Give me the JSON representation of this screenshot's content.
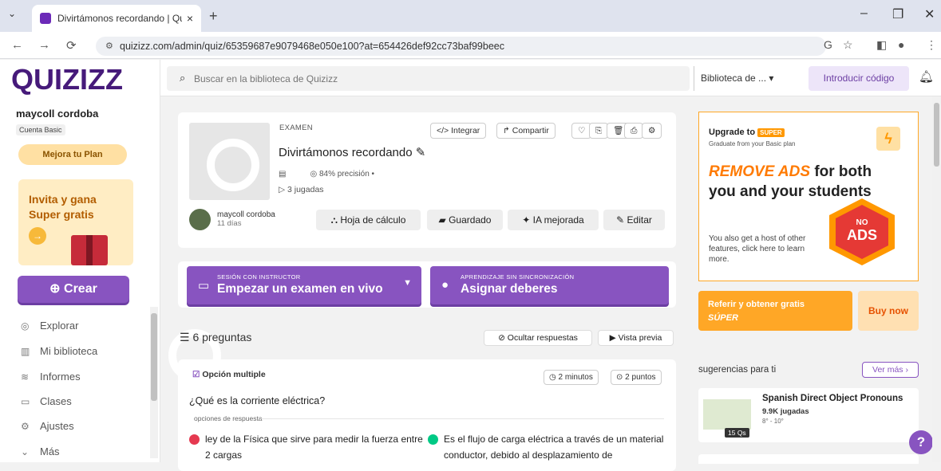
{
  "browser": {
    "tab_title": "Divirtámonos recordando | Qu",
    "url": "quizizz.com/admin/quiz/65359687e9079468e050e100?at=654426def92cc73baf99beec"
  },
  "sidebar": {
    "logo": "QUIZIZZ",
    "username": "maycoll cordoba",
    "plan_badge": "Cuenta Basic",
    "upgrade_label": "Mejora tu Plan",
    "invite_text": "Invita y gana Super gratis",
    "create_label": "⊕ Crear",
    "nav": [
      {
        "label": "Explorar",
        "icon": "explore-icon"
      },
      {
        "label": "Mi biblioteca",
        "icon": "library-icon"
      },
      {
        "label": "Informes",
        "icon": "reports-icon"
      },
      {
        "label": "Clases",
        "icon": "classes-icon"
      },
      {
        "label": "Ajustes",
        "icon": "settings-icon"
      },
      {
        "label": "Más",
        "icon": "chevron-down-icon"
      }
    ]
  },
  "topbar": {
    "search_placeholder": "Buscar en la biblioteca de Quizizz",
    "library_select": "Biblioteca de ...",
    "code_button": "Introducir código"
  },
  "quiz": {
    "type": "EXAMEN",
    "title": "Divirtámonos recordando",
    "accuracy": "84% precisión",
    "plays": "3 jugadas",
    "author": "maycoll cordoba",
    "author_time": "11 días",
    "toolbar": {
      "embed": "Integrar",
      "share": "Compartir"
    },
    "actions": {
      "spreadsheet": "Hoja de cálculo",
      "saved": "Guardado",
      "ai": "IA mejorada",
      "edit": "Editar"
    }
  },
  "play": {
    "live_small": "SESIÓN CON INSTRUCTOR",
    "live_big": "Empezar un examen en vivo",
    "async_small": "APRENDIZAJE SIN SINCRONIZACIÓN",
    "async_big": "Asignar deberes"
  },
  "questions": {
    "count_label": "6 preguntas",
    "hide_answers": "Ocultar respuestas",
    "preview": "Vista previa",
    "items": [
      {
        "type": "Opción multiple",
        "time": "2 minutos",
        "points": "2 puntos",
        "text": "¿Qué es la corriente eléctrica?",
        "options_label": "opciones de respuesta",
        "options": [
          {
            "text": "ley de la Física que sirve para medir la fuerza entre 2 cargas",
            "color": "#e53950"
          },
          {
            "text": "Es el flujo de carga eléctrica a través de un material conductor, debido al desplazamiento de",
            "color": "#00c985"
          }
        ]
      }
    ]
  },
  "ad": {
    "upgrade_to": "Upgrade to",
    "super_tag": "SUPER",
    "graduate": "Graduate from your Basic plan",
    "headline_highlight": "REMOVE ADS",
    "headline_rest": "for both you and your students",
    "hex_no": "NO",
    "hex_ads": "ADS",
    "subtext": "You also get a host of other features, click here to learn more."
  },
  "refer": {
    "line1": "Referir y obtener gratis",
    "line2": "SÚPER",
    "buy_now": "Buy now"
  },
  "suggestions": {
    "title": "sugerencias para ti",
    "see_more": "Ver más",
    "items": [
      {
        "title": "Spanish Direct Object Pronouns",
        "plays": "9.9K jugadas",
        "grade": "8° - 10°",
        "qs": "15 Qs"
      }
    ]
  },
  "colors": {
    "brand": "#8854c0",
    "logo": "#461a7a",
    "accent_orange": "#ffa726"
  }
}
